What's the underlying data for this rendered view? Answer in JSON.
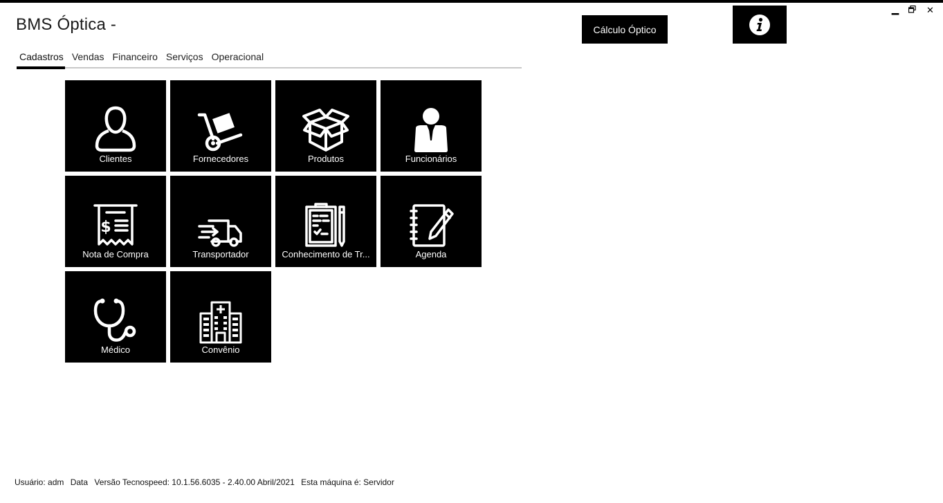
{
  "app": {
    "title": "BMS Óptica -"
  },
  "header": {
    "calculo_label": "Cálculo Óptico",
    "info_icon": "info-icon"
  },
  "window": {
    "minimize": "▁",
    "restore": "🗗",
    "close": "✕"
  },
  "tabs": [
    {
      "label": "Cadastros",
      "active": true
    },
    {
      "label": "Vendas"
    },
    {
      "label": "Financeiro"
    },
    {
      "label": "Serviços"
    },
    {
      "label": "Operacional"
    }
  ],
  "tiles": [
    {
      "label": "Clientes",
      "icon": "user-icon"
    },
    {
      "label": "Fornecedores",
      "icon": "hand-truck-icon"
    },
    {
      "label": "Produtos",
      "icon": "box-icon"
    },
    {
      "label": "Funcionários",
      "icon": "employee-icon"
    },
    {
      "label": "Nota de Compra",
      "icon": "receipt-icon"
    },
    {
      "label": "Transportador",
      "icon": "delivery-truck-icon"
    },
    {
      "label": "Conhecimento de Tr...",
      "icon": "clipboard-icon"
    },
    {
      "label": "Agenda",
      "icon": "notebook-icon"
    },
    {
      "label": "Médico",
      "icon": "stethoscope-icon"
    },
    {
      "label": "Convênio",
      "icon": "hospital-icon"
    }
  ],
  "status": {
    "usuario": "Usuário: adm",
    "data": "Data",
    "versao": "Versão Tecnospeed:  10.1.56.6035 - 2.40.00 Abril/2021",
    "maquina": "Esta máquina é: Servidor"
  },
  "colors": {
    "tile_bg": "#000000",
    "tile_fg": "#ffffff",
    "tab_underline": "#000000"
  }
}
